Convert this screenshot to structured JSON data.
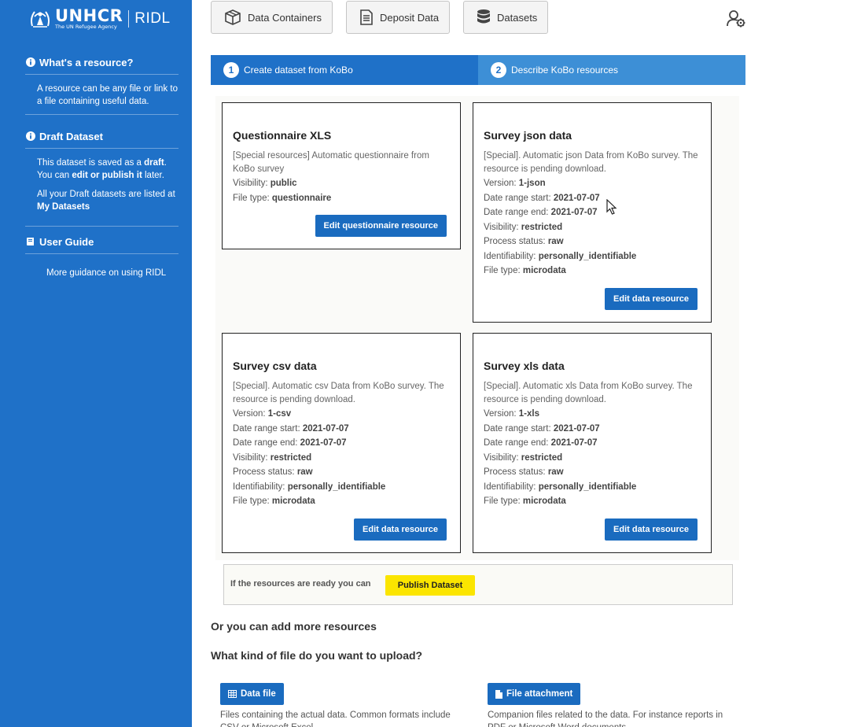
{
  "sidebar": {
    "logo": {
      "word": "UNHCR",
      "sub": "The UN Refugee Agency",
      "product": "RIDL"
    },
    "resource": {
      "title": "What's a resource?",
      "text": "A resource can be any file or link to a file containing useful data."
    },
    "draft": {
      "title": "Draft Dataset",
      "line1_pre": "This dataset is saved as a ",
      "line1_bold": "draft",
      "line1_post": ".",
      "line2_pre": "You can ",
      "line2_bold": "edit or publish it",
      "line2_post": " later.",
      "line3_pre": "All your Draft datasets are listed at ",
      "line3_bold": "My Datasets"
    },
    "guide": {
      "title": "User Guide",
      "link": "More guidance on using RIDL"
    }
  },
  "topnav": {
    "containers": "Data Containers",
    "deposit": "Deposit Data",
    "datasets": "Datasets"
  },
  "steps": {
    "s1": {
      "num": "1",
      "label": "Create dataset from KoBo"
    },
    "s2": {
      "num": "2",
      "label": "Describe KoBo resources"
    }
  },
  "labels": {
    "version": "Version: ",
    "date_start": "Date range start: ",
    "date_end": "Date range end: ",
    "visibility": "Visibility: ",
    "process": "Process status: ",
    "identifiability": "Identifiability: ",
    "filetype": "File type: "
  },
  "cards": {
    "qxls": {
      "title": "Questionnaire XLS",
      "desc": "[Special resources] Automatic questionnaire from KoBo survey",
      "visibility": "public",
      "filetype": "questionnaire",
      "button": "Edit questionnaire resource"
    },
    "json": {
      "title": "Survey json data",
      "desc": "[Special]. Automatic json Data from KoBo survey. The resource is pending download.",
      "version": "1-json",
      "date_start": "2021-07-07",
      "date_end": "2021-07-07",
      "visibility": "restricted",
      "process": "raw",
      "identifiability": "personally_identifiable",
      "filetype": "microdata",
      "button": "Edit data resource"
    },
    "csv": {
      "title": "Survey csv data",
      "desc": "[Special]. Automatic csv Data from KoBo survey. The resource is pending download.",
      "version": "1-csv",
      "date_start": "2021-07-07",
      "date_end": "2021-07-07",
      "visibility": "restricted",
      "process": "raw",
      "identifiability": "personally_identifiable",
      "filetype": "microdata",
      "button": "Edit data resource"
    },
    "xls": {
      "title": "Survey xls data",
      "desc": "[Special]. Automatic xls Data from KoBo survey. The resource is pending download.",
      "version": "1-xls",
      "date_start": "2021-07-07",
      "date_end": "2021-07-07",
      "visibility": "restricted",
      "process": "raw",
      "identifiability": "personally_identifiable",
      "filetype": "microdata",
      "button": "Edit data resource"
    }
  },
  "publish": {
    "text": "If the resources are ready you can",
    "button": "Publish Dataset"
  },
  "more": {
    "title": "Or you can add more resources",
    "question": "What kind of file do you want to upload?",
    "datafile": {
      "label": "Data file",
      "text": "Files containing the actual data. Common formats include CSV or Microsoft Excel."
    },
    "attachment": {
      "label": "File attachment",
      "text": "Companion files related to the data. For instance reports in PDF or Microsoft Word documents."
    }
  },
  "colors": {
    "sidebar": "#1f71c8",
    "primary_button": "#1a6bbf",
    "publish_button": "#fbe500"
  }
}
